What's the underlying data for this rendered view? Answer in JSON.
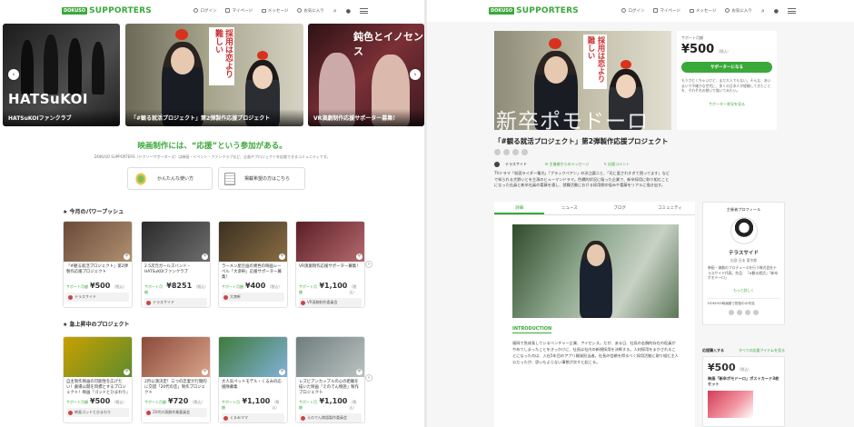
{
  "left": {
    "header": {
      "logo_badge": "DOKUSO",
      "logo_text": "SUPPORTERS",
      "nav": {
        "login": "ログイン",
        "mypage": "マイページ",
        "message": "メッセージ",
        "favorite": "お気に入り"
      }
    },
    "slides": [
      {
        "caption": "HATSuKOIファンクラブ",
        "art": "HATSuKOI"
      },
      {
        "caption": "「#観る就活プロジェクト」第2弾製作応援プロジェクト",
        "art": "採用は恋より難しい"
      },
      {
        "caption": "VR演劇制作応援サポーター募集！",
        "art": "鈍色とイノセンス"
      }
    ],
    "tagline": "映画制作には、“応援”という参加がある。",
    "tagline_sub": "DOKUSO SUPPORTERS（ドクソーサポーターズ）は映画・イベント・ファンクラブなど、企画やプロジェクトを応援できるコミュニティです。",
    "guide_buttons": [
      "かんたんな使い方",
      "掲載希望の方はこちら"
    ],
    "section1": "今月のパワープッシュ",
    "section2": "急上昇中のプロジェクト",
    "price_label": "サポート月額",
    "price_unit": "（税込）",
    "cards1": [
      {
        "title": "「#観る就活プロジェクト」第2弾製作応援プロジェクト",
        "price": "¥500",
        "owner": "テラスサイド",
        "c1": "#6b4a3a",
        "c2": "#b0916f"
      },
      {
        "title": "2.5次元ガールズバンド・HATSuKOIファンクラブ",
        "price": "¥8251",
        "owner": "テラスサイド",
        "c1": "#2a2a2a",
        "c2": "#6e6e6e"
      },
      {
        "title": "ラーメン屋企画の異色の映画レーベル「大衆軒」応援サポーター募集！",
        "price": "¥400",
        "owner": "大衆軒",
        "c1": "#3a3020",
        "c2": "#8a6c44"
      },
      {
        "title": "VR演劇制作応援サポーター募集！",
        "price": "¥1,100",
        "owner": "VR演劇制作委員会",
        "c1": "#5a1e26",
        "c2": "#b56a6e"
      }
    ],
    "cards2": [
      {
        "title": "自主制作映画の可能性を広げたい！劇場公開を目標とするプロジェクト！映画『ゴッドとひまわり』",
        "price": "¥500",
        "owner": "映画ゴッドとひまわり",
        "c1": "#c9a000",
        "c2": "#5f8b2c"
      },
      {
        "title": "2月公演決定！三つの恋愛が行間的に交錯「20代の恋」制作プロジェクト",
        "price": "¥720",
        "owner": "20代の演劇作業委員会",
        "c1": "#8a4a3a",
        "c2": "#d9a48a"
      },
      {
        "title": "大人気ペットモデル・くるみの応援隊募集",
        "price": "¥1,100",
        "owner": "くるみママ",
        "c1": "#3f7a3a",
        "c2": "#7fb1d9"
      },
      {
        "title": "レズビアンカップルの心の距離を描いた映画「えのでん物語」製作プロジェクト",
        "price": "¥1,100",
        "owner": "えのでん物語製作委員会",
        "c1": "#6f7d7e",
        "c2": "#b9c2c0"
      }
    ]
  },
  "right": {
    "header": {
      "logo_badge": "DOKUSO",
      "logo_text": "SUPPORTERS",
      "nav": {
        "login": "ログイン",
        "mypage": "マイページ",
        "message": "メッセージ",
        "favorite": "お気に入り"
      }
    },
    "hero_overlay": "新卒ポモドーロ",
    "hero_sign": "採用は恋より難しい",
    "support_price_label": "サポート月額",
    "support_price": "¥500",
    "support_unit": "（税込）",
    "support_button": "サポーターになる",
    "support_desc": "もうさむくちゃいけど、まだ大人でもない。そんな、あいまいで不確かな世代に、多くの日本人が経験してきたことを、それぞれの想いで描いてみたい。",
    "support_list_link": "サポーター状況を見る",
    "title": "「#観る就活プロジェクト」第2弾製作応援プロジェクト",
    "owner": "テラスサイド",
    "links": [
      "主催者からのメッセージ",
      "応援コメント"
    ],
    "description": "TVドラマ「仮面ライダー電光」「ブラックペアン」の渋江譲二と、「司に愛されすぎて困ってます」などで知られる大野いとを主演のヒューマンドラマ。色欄的状況に陥った企業で、新卒採用に取り組むことになった社員と新卒社員の葛藤を通し、就職活動における採用側の悩みや葛藤をリアルに描き出す。",
    "tabs": [
      "詳細",
      "ニュース",
      "ブログ",
      "コミュニティ"
    ],
    "intro_heading": "INTRODUCTION",
    "intro_text": "福岡で急成長しているベンチャー企業、アイセシス。だが、ある日、社長の右腕的存在の役員がやめてしまったことをきっかけに、社長は社内の新規採用を決断する。人材採用をまかされることになったのは、入社5年目のアプリ開発担当者。社長の信頼を得るべく採用活動に取り組む主人公だったが、思いもよらない事態が次々と起こる。",
    "profile_heading": "主催者プロフィール",
    "profile_name": "テラスサイド",
    "profile_loc": "出身 日本 東京都",
    "profile_text": "映画・演劇のプロデュースを行う株式会社テラスサイド代表。作品：「#観る就活」「新卒ポモドーロ」",
    "profile_more": "もっと詳しく",
    "profile_badge": "DOKUSO映画館で配信中の作品",
    "reward_heading": "応援購入する",
    "reward_link": "すべての応援アイテムを見る",
    "reward_price": "¥500",
    "reward_unit": "（税込）",
    "reward_title": "映画「新卒ポモドーロ」ポストカード3枚セット"
  }
}
